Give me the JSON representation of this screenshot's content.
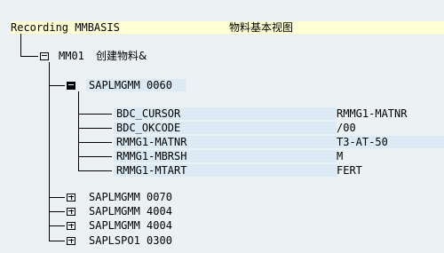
{
  "root": {
    "label": "Recording MMBASIS",
    "description": "物料基本视图"
  },
  "transaction": {
    "code": "MM01",
    "text": "创建物料&"
  },
  "screens": [
    {
      "program": "SAPLMGMM",
      "dynpro": "0060",
      "expanded": true
    },
    {
      "program": "SAPLMGMM",
      "dynpro": "0070",
      "expanded": false
    },
    {
      "program": "SAPLMGMM",
      "dynpro": "4004",
      "expanded": false
    },
    {
      "program": "SAPLMGMM",
      "dynpro": "4004",
      "expanded": false
    },
    {
      "program": "SAPLSPO1",
      "dynpro": "0300",
      "expanded": false
    }
  ],
  "fields": [
    {
      "name": "BDC_CURSOR",
      "value": "RMMG1-MATNR"
    },
    {
      "name": "BDC_OKCODE",
      "value": "/00"
    },
    {
      "name": "RMMG1-MATNR",
      "value": "T3-AT-50"
    },
    {
      "name": "RMMG1-MBRSH",
      "value": "M"
    },
    {
      "name": "RMMG1-MTART",
      "value": "FERT"
    }
  ],
  "colors": {
    "background": "#ecf2f4",
    "highlight_yellow": "#ffffd6",
    "highlight_blue": "#dceaf6"
  },
  "icons": {
    "folder_open": "folder-open-icon",
    "folder_closed": "folder-closed-icon"
  }
}
